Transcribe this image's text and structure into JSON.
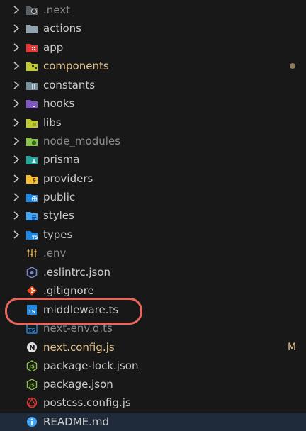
{
  "explorer": {
    "folders": [
      {
        "label": ".next",
        "icon": "next-folder-icon"
      },
      {
        "label": "actions",
        "icon": "folder-icon"
      },
      {
        "label": "app",
        "icon": "app-folder-icon"
      },
      {
        "label": "components",
        "icon": "components-folder-icon"
      },
      {
        "label": "constants",
        "icon": "constants-folder-icon"
      },
      {
        "label": "hooks",
        "icon": "hooks-folder-icon"
      },
      {
        "label": "libs",
        "icon": "libs-folder-icon"
      },
      {
        "label": "node_modules",
        "icon": "node-modules-folder-icon"
      },
      {
        "label": "prisma",
        "icon": "prisma-folder-icon"
      },
      {
        "label": "providers",
        "icon": "providers-folder-icon"
      },
      {
        "label": "public",
        "icon": "public-folder-icon"
      },
      {
        "label": "styles",
        "icon": "styles-folder-icon"
      },
      {
        "label": "types",
        "icon": "types-folder-icon"
      }
    ],
    "files": [
      {
        "label": ".env",
        "icon": "env-file-icon"
      },
      {
        "label": ".eslintrc.json",
        "icon": "eslint-file-icon"
      },
      {
        "label": ".gitignore",
        "icon": "git-file-icon"
      },
      {
        "label": "middleware.ts",
        "icon": "typescript-file-icon"
      },
      {
        "label": "next-env.d.ts",
        "icon": "typescript-def-file-icon"
      },
      {
        "label": "next.config.js",
        "icon": "next-config-file-icon"
      },
      {
        "label": "package-lock.json",
        "icon": "npm-json-file-icon"
      },
      {
        "label": "package.json",
        "icon": "npm-json-file-icon"
      },
      {
        "label": "postcss.config.js",
        "icon": "postcss-file-icon"
      },
      {
        "label": "README.md",
        "icon": "info-file-icon"
      }
    ],
    "modified_badge": "M",
    "colors": {
      "modified": "#e2c08d",
      "ignored": "#8c8c8c",
      "default": "#cccccc",
      "highlight_ring": "#e8665a"
    }
  }
}
